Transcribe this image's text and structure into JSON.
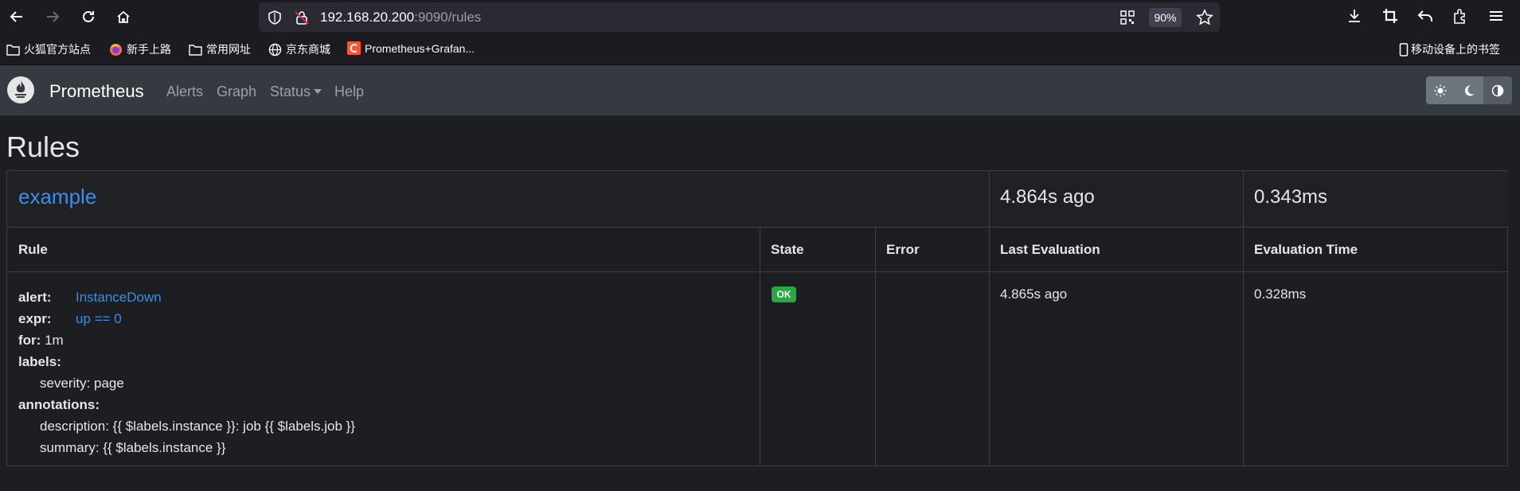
{
  "browser": {
    "url_host": "192.168.20.200",
    "url_rest": ":9090/rules",
    "zoom": "90%"
  },
  "bookmarks": [
    {
      "label": "火狐官方站点",
      "icon": "folder-icon"
    },
    {
      "label": "新手上路",
      "icon": "firefox-icon"
    },
    {
      "label": "常用网址",
      "icon": "folder-icon"
    },
    {
      "label": "京东商城",
      "icon": "globe-icon"
    },
    {
      "label": "Prometheus+Grafan...",
      "icon": "c-logo-icon"
    }
  ],
  "mobile_bookmarks": "移动设备上的书签",
  "navbar": {
    "brand": "Prometheus",
    "links": [
      "Alerts",
      "Graph",
      "Status",
      "Help"
    ]
  },
  "page": {
    "title": "Rules"
  },
  "group": {
    "name": "example",
    "last_evaluation": "4.864s ago",
    "evaluation_time": "0.343ms"
  },
  "table": {
    "headers": [
      "Rule",
      "State",
      "Error",
      "Last Evaluation",
      "Evaluation Time"
    ]
  },
  "rule": {
    "alert_key": "alert:",
    "alert_value": "InstanceDown",
    "expr_key": "expr:",
    "expr_value": "up == 0",
    "for_key": "for:",
    "for_value": "1m",
    "labels_key": "labels:",
    "label_line": "severity: page",
    "annotations_key": "annotations:",
    "annotation_description": "description: {{ $labels.instance }}: job {{ $labels.job }}",
    "annotation_summary": "summary: {{ $labels.instance }}",
    "state": "OK",
    "error": "",
    "last_evaluation": "4.865s ago",
    "evaluation_time": "0.328ms"
  },
  "colors": {
    "link": "#3b8de6",
    "ok_badge": "#28a745",
    "navbar": "#343a40",
    "background": "#1c1e22"
  }
}
